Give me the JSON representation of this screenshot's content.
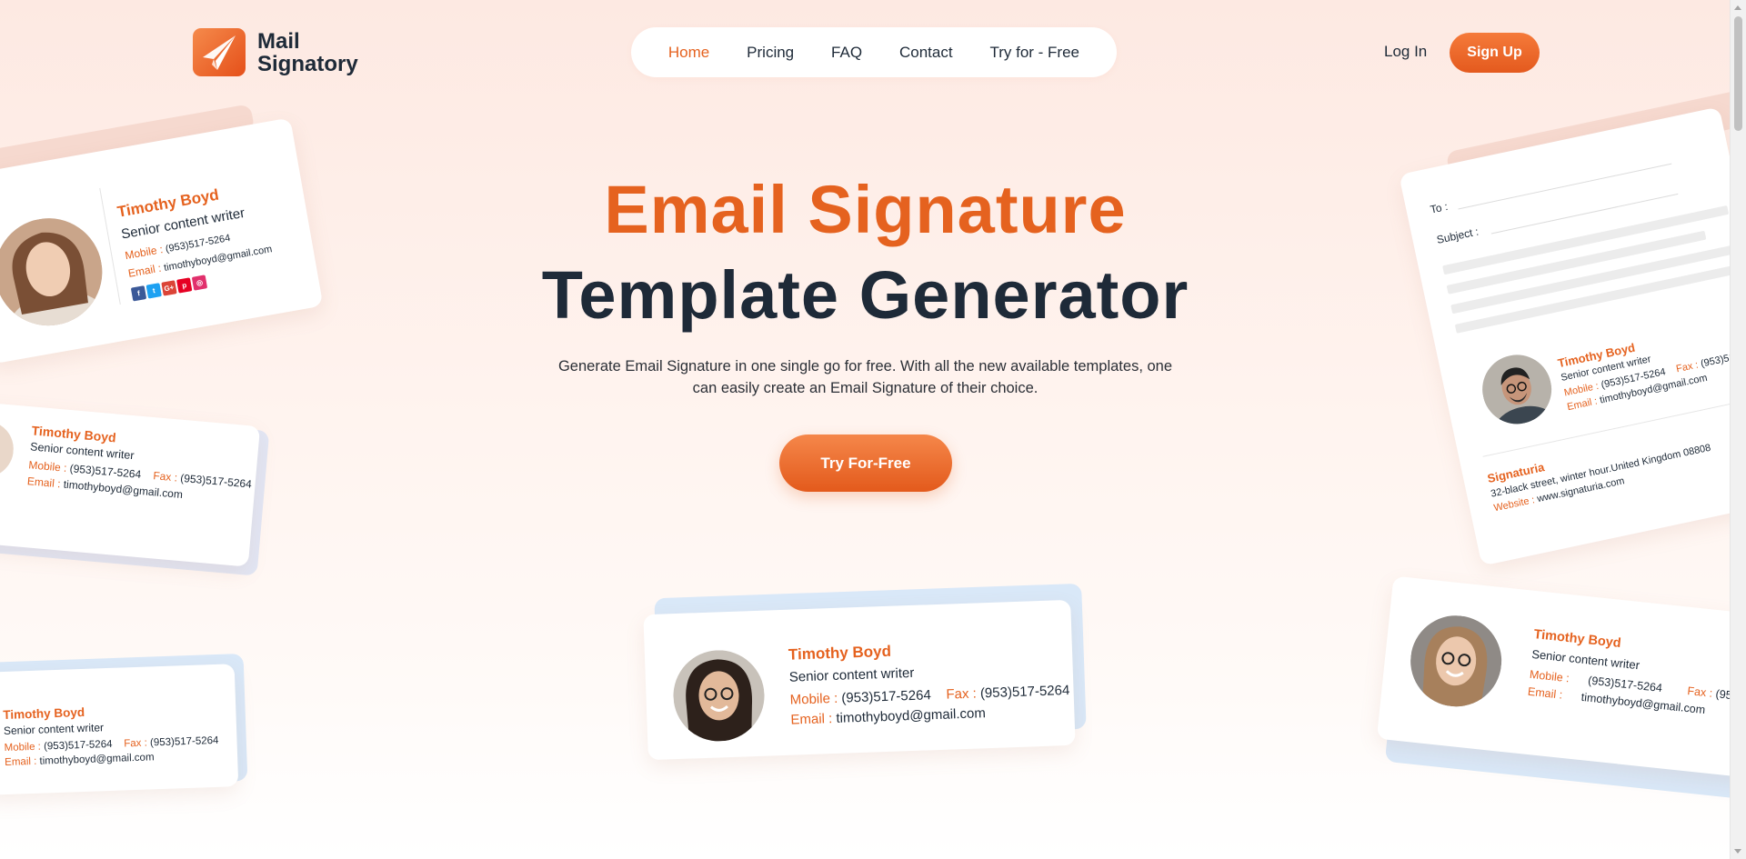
{
  "brand": {
    "line1": "Mail",
    "line2": "Signatory"
  },
  "nav": {
    "items": [
      {
        "label": "Home",
        "active": true
      },
      {
        "label": "Pricing",
        "active": false
      },
      {
        "label": "FAQ",
        "active": false
      },
      {
        "label": "Contact",
        "active": false
      },
      {
        "label": "Try for - Free",
        "active": false
      }
    ]
  },
  "header": {
    "login": "Log In",
    "signup": "Sign Up"
  },
  "hero": {
    "title_line1": "Email Signature",
    "title_line2": "Template Generator",
    "description": "Generate Email Signature in one single go for free. With all the new available templates, one can easily create an Email Signature of their choice.",
    "cta": "Try For-Free"
  },
  "signature": {
    "name": "Timothy Boyd",
    "role": "Senior content writer",
    "mobile_label": "Mobile :",
    "mobile": "(953)517-5264",
    "fax_label": "Fax :",
    "fax": "(953)517-5264",
    "email_label": "Email :",
    "email": "timothyboyd@gmail.com"
  },
  "email_card": {
    "to_label": "To :",
    "subject_label": "Subject :",
    "company": "Signaturia",
    "address": "32-black street, winter hour.United Kingdom 08808",
    "website_label": "Website :",
    "website": "www.signaturia.com"
  },
  "socials": [
    "f",
    "t",
    "G+",
    "p",
    "◎"
  ],
  "colors": {
    "accent": "#e5621f",
    "dark": "#1e2a38"
  }
}
